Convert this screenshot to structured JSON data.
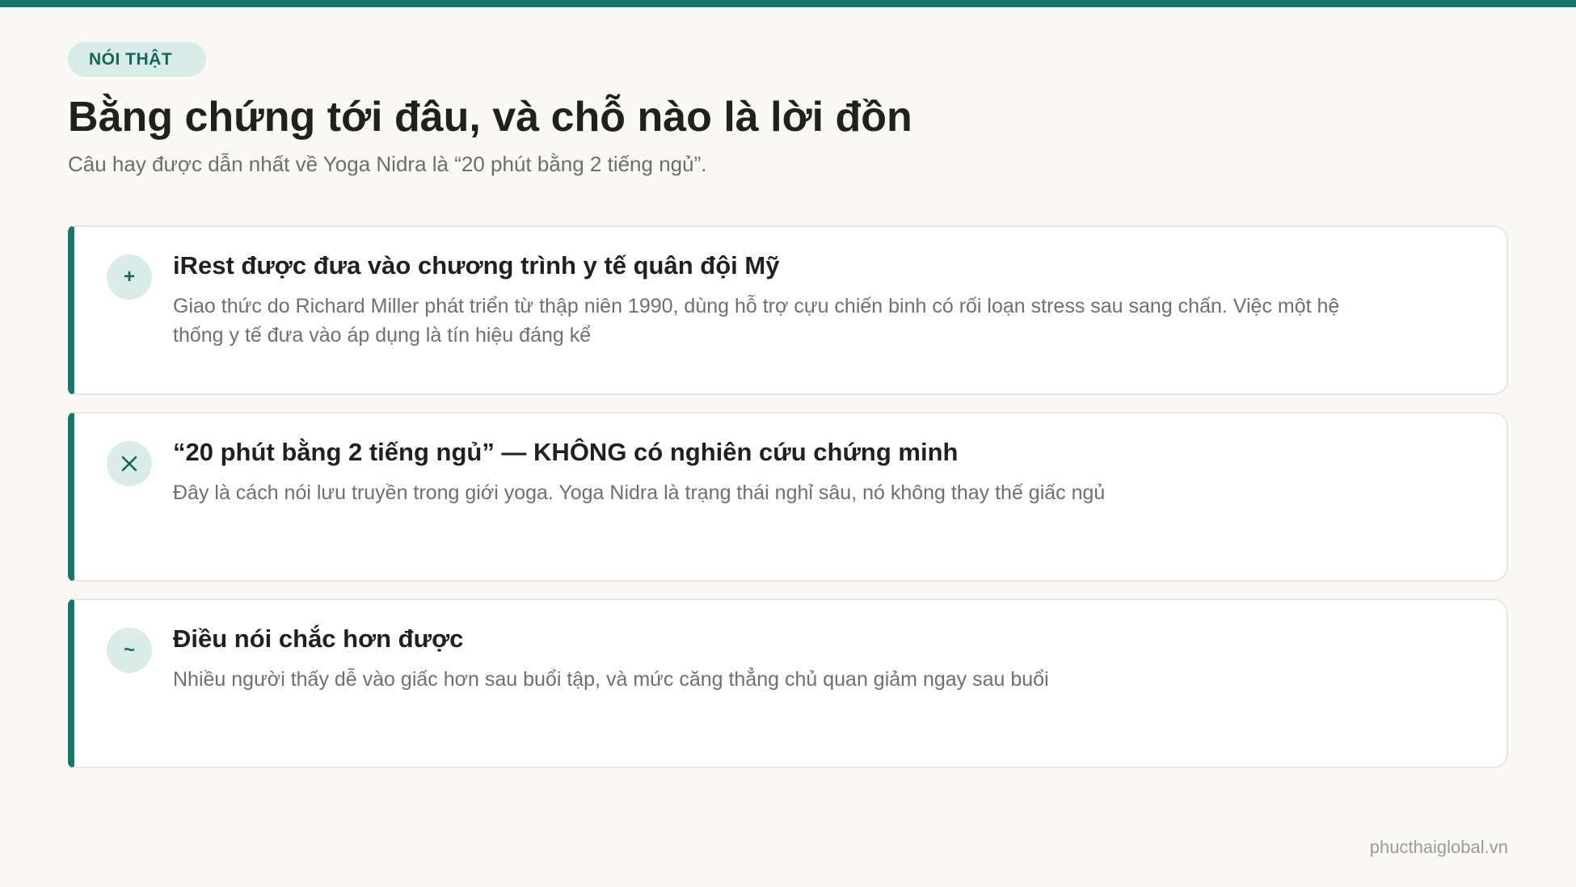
{
  "colors": {
    "accent": "#18756c",
    "background": "#f9f8f5",
    "badge_bg": "#d7ebe7"
  },
  "badge": "NÓI THẬT",
  "title": "Bằng chứng tới đâu, và chỗ nào là lời đồn",
  "subtitle": "Câu hay được dẫn nhất về Yoga Nidra là “20 phút bằng 2 tiếng ngủ”.",
  "cards": [
    {
      "icon": "plus-icon",
      "glyph": "+",
      "title": "iRest được đưa vào chương trình y tế quân đội Mỹ",
      "text": "Giao thức do Richard Miller phát triển từ thập niên 1990, dùng hỗ trợ cựu chiến binh có rối loạn stress sau sang chấn. Việc một hệ thống y tế đưa vào áp dụng là tín hiệu đáng kể"
    },
    {
      "icon": "close-icon",
      "glyph": "",
      "title": "“20 phút bằng 2 tiếng ngủ” — KHÔNG có nghiên cứu chứng minh",
      "text": "Đây là cách nói lưu truyền trong giới yoga. Yoga Nidra là trạng thái nghỉ sâu, nó không thay thế giấc ngủ"
    },
    {
      "icon": "tilde-icon",
      "glyph": "~",
      "title": "Điều nói chắc hơn được",
      "text": "Nhiều người thấy dễ vào giấc hơn sau buổi tập, và mức căng thẳng chủ quan giảm ngay sau buổi"
    }
  ],
  "footer": "phucthaiglobal.vn"
}
